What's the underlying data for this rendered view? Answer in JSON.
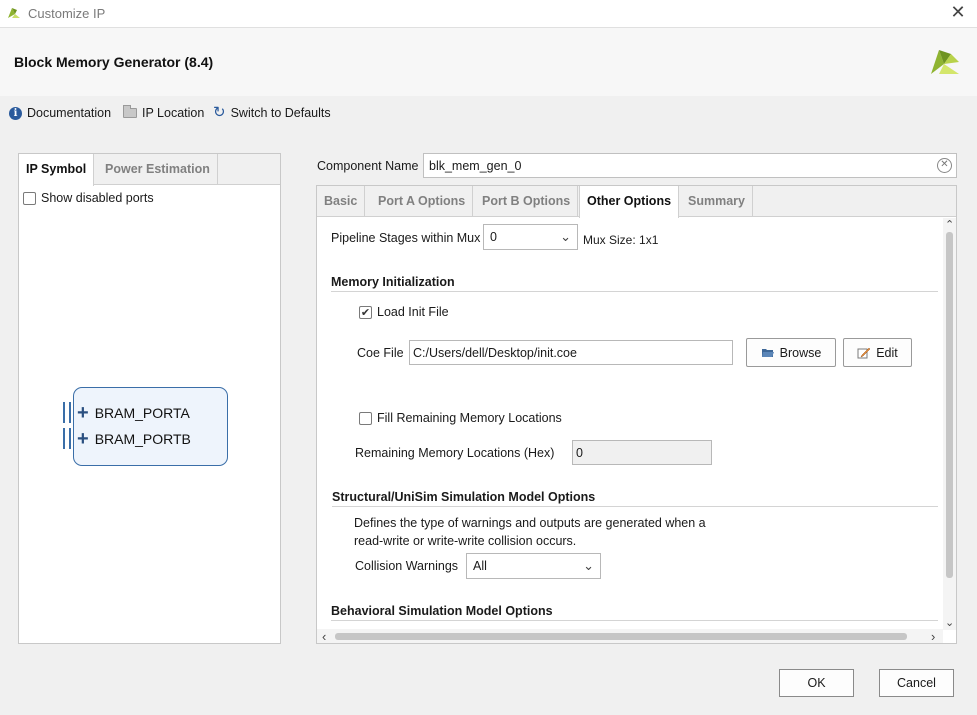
{
  "window": {
    "title": "Customize IP",
    "close_glyph": "✕",
    "app_logo_icon": "xilinx-logo"
  },
  "header": {
    "title": "Block Memory Generator (8.4)"
  },
  "toolbar": {
    "documentation": "Documentation",
    "ip_location": "IP Location",
    "switch_defaults": "Switch to Defaults"
  },
  "left_panel": {
    "tabs": [
      "IP Symbol",
      "Power Estimation"
    ],
    "active_tab": 0,
    "show_disabled_ports": "Show disabled ports",
    "show_disabled_checked": false,
    "ports": [
      "BRAM_PORTA",
      "BRAM_PORTB"
    ]
  },
  "component": {
    "label": "Component Name",
    "value": "blk_mem_gen_0"
  },
  "right_panel": {
    "tabs": [
      "Basic",
      "Port A Options",
      "Port B Options",
      "Other Options",
      "Summary"
    ],
    "active_tab": 3,
    "pipeline": {
      "label": "Pipeline Stages within Mux",
      "value": "0",
      "mux_size": "Mux Size: 1x1"
    },
    "memory_init": {
      "title": "Memory Initialization",
      "load_init_label": "Load Init File",
      "load_init_checked": true,
      "coe_label": "Coe File",
      "coe_value": "C:/Users/dell/Desktop/init.coe",
      "browse": "Browse",
      "edit": "Edit",
      "fill_label": "Fill Remaining Memory Locations",
      "fill_checked": false,
      "remaining_label": "Remaining Memory Locations (Hex)",
      "remaining_value": "0"
    },
    "structural": {
      "title": "Structural/UniSim Simulation Model Options",
      "desc_line1": "Defines the type of warnings and outputs are generated when a",
      "desc_line2": "read-write or write-write collision occurs.",
      "collision_label": "Collision Warnings",
      "collision_value": "All"
    },
    "behavioral": {
      "title": "Behavioral Simulation Model Options"
    }
  },
  "footer": {
    "ok": "OK",
    "cancel": "Cancel"
  },
  "colors": {
    "accent_blue": "#3a6ea8",
    "logo_green": "#a7c93a"
  }
}
